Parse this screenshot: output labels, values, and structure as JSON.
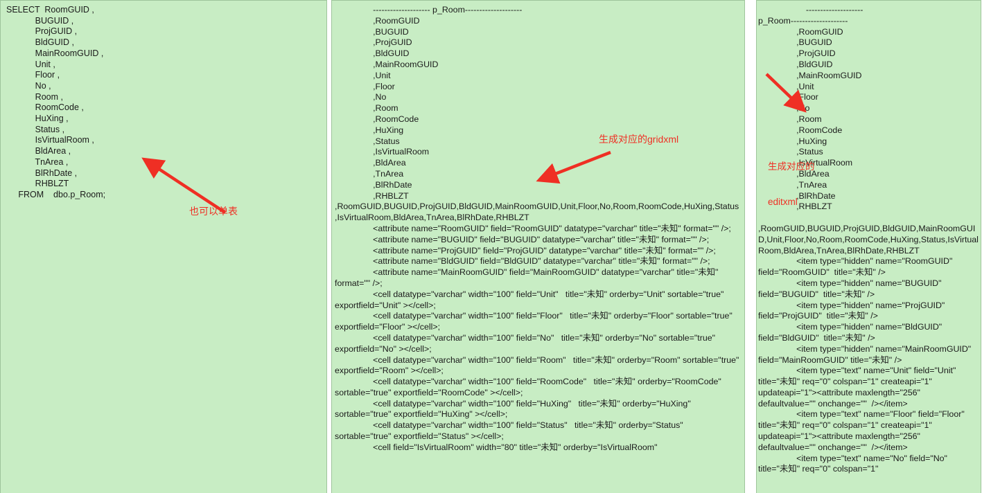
{
  "meta": {
    "background_color": "#c8edc4",
    "text_color": "#1a1a1a",
    "annotation_color": "#ef2f24"
  },
  "panels": {
    "left": {
      "name": "sql-select-panel",
      "code": "SELECT  RoomGUID ,\n            BUGUID ,\n            ProjGUID ,\n            BldGUID ,\n            MainRoomGUID ,\n            Unit ,\n            Floor ,\n            No ,\n            Room ,\n            RoomCode ,\n            HuXing ,\n            Status ,\n            IsVirtualRoom ,\n            BldArea ,\n            TnArea ,\n            BlRhDate ,\n            RHBLZT\n     FROM    dbo.p_Room;",
      "annotation": "也可以单表"
    },
    "middle": {
      "name": "gridxml-output-panel",
      "code": "                -------------------- p_Room--------------------\n                ,RoomGUID\n                ,BUGUID\n                ,ProjGUID\n                ,BldGUID\n                ,MainRoomGUID\n                ,Unit\n                ,Floor\n                ,No\n                ,Room\n                ,RoomCode\n                ,HuXing\n                ,Status\n                ,IsVirtualRoom\n                ,BldArea\n                ,TnArea\n                ,BlRhDate\n                ,RHBLZT\n,RoomGUID,BUGUID,ProjGUID,BldGUID,MainRoomGUID,Unit,Floor,No,Room,RoomCode,HuXing,Status,IsVirtualRoom,BldArea,TnArea,BlRhDate,RHBLZT\n                <attribute name=\"RoomGUID\" field=\"RoomGUID\" datatype=\"varchar\" title=\"未知\" format=\"\" />;\n                <attribute name=\"BUGUID\" field=\"BUGUID\" datatype=\"varchar\" title=\"未知\" format=\"\" />;\n                <attribute name=\"ProjGUID\" field=\"ProjGUID\" datatype=\"varchar\" title=\"未知\" format=\"\" />;\n                <attribute name=\"BldGUID\" field=\"BldGUID\" datatype=\"varchar\" title=\"未知\" format=\"\" />;\n                <attribute name=\"MainRoomGUID\" field=\"MainRoomGUID\" datatype=\"varchar\" title=\"未知\"  format=\"\" />;\n                <cell datatype=\"varchar\" width=\"100\" field=\"Unit\"   title=\"未知\" orderby=\"Unit\" sortable=\"true\" exportfield=\"Unit\" ></cell>;\n                <cell datatype=\"varchar\" width=\"100\" field=\"Floor\"   title=\"未知\" orderby=\"Floor\" sortable=\"true\" exportfield=\"Floor\" ></cell>;\n                <cell datatype=\"varchar\" width=\"100\" field=\"No\"   title=\"未知\" orderby=\"No\" sortable=\"true\" exportfield=\"No\" ></cell>;\n                <cell datatype=\"varchar\" width=\"100\" field=\"Room\"   title=\"未知\" orderby=\"Room\" sortable=\"true\" exportfield=\"Room\" ></cell>;\n                <cell datatype=\"varchar\" width=\"100\" field=\"RoomCode\"   title=\"未知\" orderby=\"RoomCode\" sortable=\"true\" exportfield=\"RoomCode\" ></cell>;\n                <cell datatype=\"varchar\" width=\"100\" field=\"HuXing\"   title=\"未知\" orderby=\"HuXing\" sortable=\"true\" exportfield=\"HuXing\" ></cell>;\n                <cell datatype=\"varchar\" width=\"100\" field=\"Status\"   title=\"未知\" orderby=\"Status\" sortable=\"true\" exportfield=\"Status\" ></cell>;\n                <cell field=\"IsVirtualRoom\" width=\"80\" title=\"未知\" orderby=\"IsVirtualRoom\"",
      "annotation": "生成对应的gridxml"
    },
    "right": {
      "name": "editxml-output-panel",
      "code": "                    --------------------\np_Room--------------------\n                ,RoomGUID\n                ,BUGUID\n                ,ProjGUID\n                ,BldGUID\n                ,MainRoomGUID\n                ,Unit\n                ,Floor\n                ,No\n                ,Room\n                ,RoomCode\n                ,HuXing\n                ,Status\n                ,IsVirtualRoom\n                ,BldArea\n                ,TnArea\n                ,BlRhDate\n                ,RHBLZT\n       ,RoomGUID,BUGUID,ProjGUID,BldGUID,MainRoomGUID,Unit,Floor,No,Room,RoomCode,HuXing,Status,IsVirtualRoom,BldArea,TnArea,BlRhDate,RHBLZT\n                <item type=\"hidden\" name=\"RoomGUID\" field=\"RoomGUID\"  title=\"未知\" />\n                <item type=\"hidden\" name=\"BUGUID\" field=\"BUGUID\"  title=\"未知\" />\n                <item type=\"hidden\" name=\"ProjGUID\" field=\"ProjGUID\"  title=\"未知\" />\n                <item type=\"hidden\" name=\"BldGUID\" field=\"BldGUID\"  title=\"未知\" />\n                <item type=\"hidden\" name=\"MainRoomGUID\" field=\"MainRoomGUID\" title=\"未知\" />\n                <item type=\"text\" name=\"Unit\" field=\"Unit\" title=\"未知\" req=\"0\" colspan=\"1\" createapi=\"1\" updateapi=\"1\"><attribute maxlength=\"256\" defaultvalue=\"\" onchange=\"\"  /></item>\n                <item type=\"text\" name=\"Floor\" field=\"Floor\" title=\"未知\" req=\"0\" colspan=\"1\" createapi=\"1\" updateapi=\"1\"><attribute maxlength=\"256\" defaultvalue=\"\" onchange=\"\"  /></item>\n                <item type=\"text\" name=\"No\" field=\"No\" title=\"未知\" req=\"0\" colspan=\"1\"",
      "annotation_line1": "生成对应的",
      "annotation_line2": "editxml"
    }
  }
}
